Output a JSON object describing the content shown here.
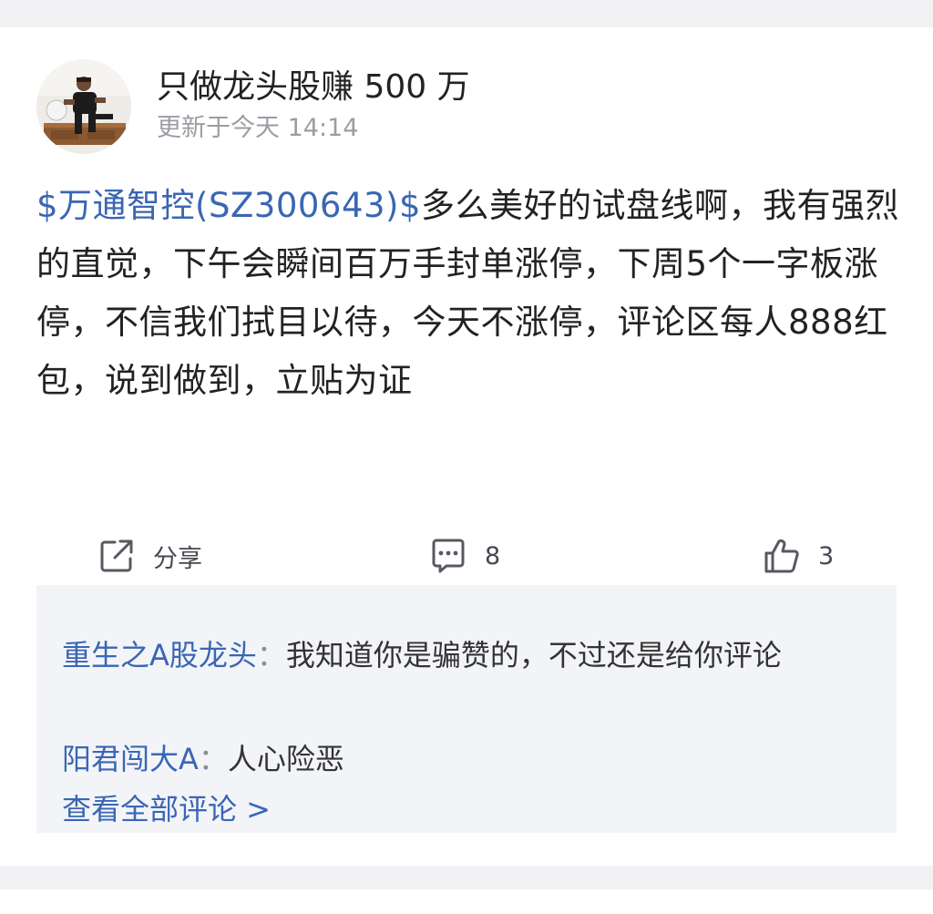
{
  "post": {
    "author_name": "只做龙头股赚 500 万",
    "time": "更新于今天 14:14",
    "stock_link": "$万通智控(SZ300643)$",
    "text": "多么美好的试盘线啊，我有强烈的直觉，下午会瞬间百万手封单涨停，下周5个一字板涨停，不信我们拭目以待，今天不涨停，评论区每人888红包，说到做到，立贴为证"
  },
  "actions": {
    "share_label": "分享",
    "comment_count": "8",
    "like_count": "3"
  },
  "comments": [
    {
      "author": "重生之A股龙头",
      "separator": "：",
      "text": "我知道你是骗赞的，不过还是给你评论"
    },
    {
      "author": "阳君闯大A",
      "separator": "：",
      "text": "人心险恶"
    }
  ],
  "view_all_label": "查看全部评论 >",
  "colors": {
    "link": "#3a66b3",
    "text": "#222222",
    "muted": "#9a9da3",
    "comment_bg": "#f2f4f8",
    "page_bg": "#f2f2f4"
  },
  "icons": {
    "avatar": "avatar-photo",
    "share": "share-icon",
    "comment": "comment-icon",
    "like": "thumbs-up-icon"
  }
}
